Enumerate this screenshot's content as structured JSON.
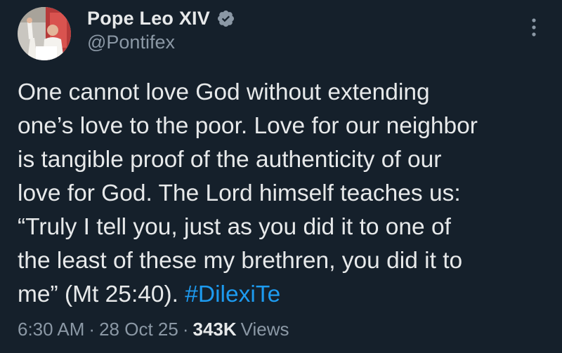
{
  "author": {
    "display_name": "Pope Leo XIV",
    "handle": "@Pontifex",
    "verified_badge_color": "#8b98a5",
    "avatar_icon": "avatar-image"
  },
  "tweet": {
    "text_main": "One cannot love God without extending\none’s love to the poor. Love for our neighbor\nis tangible proof of the authenticity of our\nlove for God. The Lord himself teaches us:\n“Truly I tell you, just as you did it to one of\nthe least of these my brethren, you did it to\nme” (Mt 25:40). ",
    "hashtag": "#DilexiTe",
    "hashtag_color": "#1d9bf0"
  },
  "meta": {
    "time": "6:30 AM",
    "separator": "·",
    "date": "28 Oct 25",
    "views_count": "343K",
    "views_label": "Views"
  },
  "menu": {
    "icon": "more-vertical-icon"
  },
  "colors": {
    "background": "#15202b",
    "text_primary": "#e7e9ea",
    "text_secondary": "#8b98a5"
  }
}
